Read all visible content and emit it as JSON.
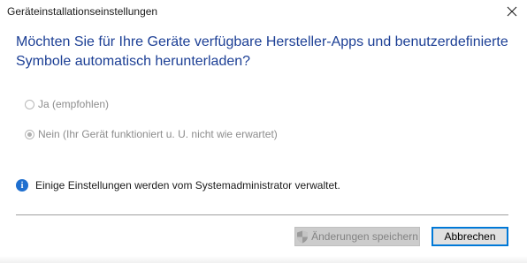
{
  "window": {
    "title": "Geräteinstallationseinstellungen"
  },
  "dialog": {
    "question": "Möchten Sie für Ihre Geräte verfügbare Hersteller-Apps und benutzerdefinierte Symbole automatisch herunterladen?",
    "options": [
      {
        "label": "Ja (empfohlen)",
        "selected": false,
        "enabled": false
      },
      {
        "label": "Nein (Ihr Gerät funktioniert u. U. nicht wie erwartet)",
        "selected": true,
        "enabled": false
      }
    ],
    "info_text": "Einige Einstellungen werden vom Systemadministrator verwaltet."
  },
  "buttons": {
    "save_label": "Änderungen speichern",
    "cancel_label": "Abbrechen"
  },
  "colors": {
    "heading": "#1c3f95",
    "info_icon": "#1f6fcf",
    "focus_border": "#0078d7"
  },
  "icons": {
    "close": "close-icon",
    "info": "info-icon",
    "shield": "uac-shield-icon"
  }
}
